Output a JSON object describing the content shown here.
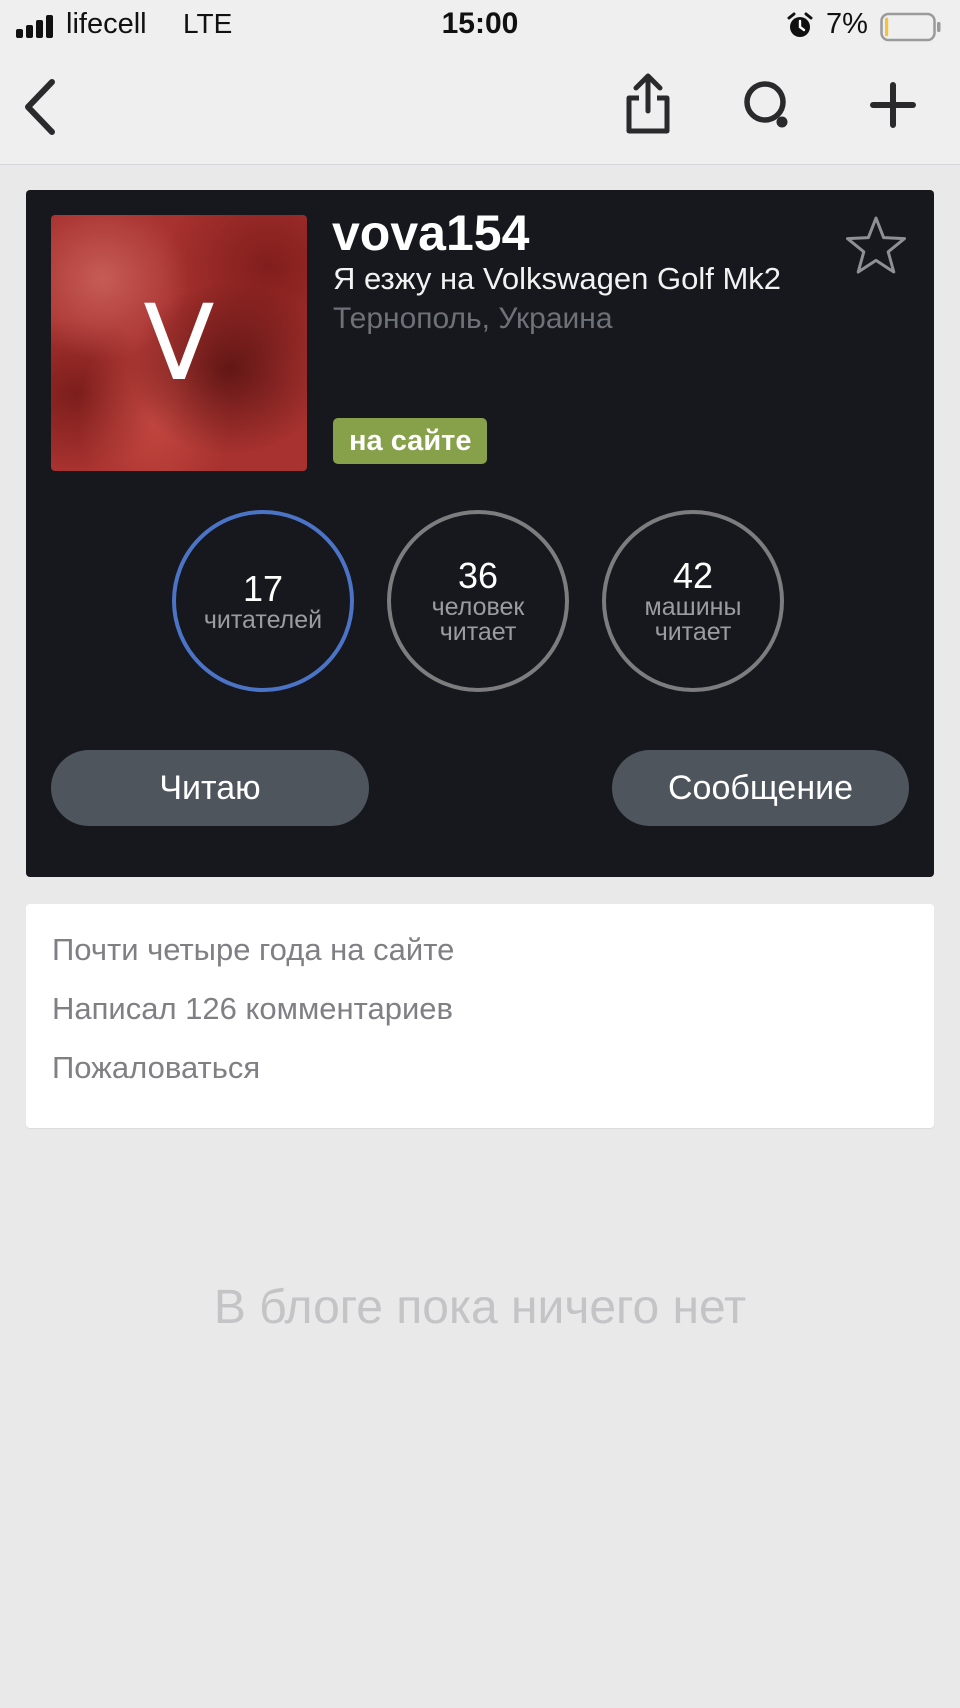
{
  "status_bar": {
    "carrier": "lifecell",
    "network": "LTE",
    "time": "15:00",
    "battery_percent": "7%",
    "battery_level": 0.07,
    "icons": [
      "signal-icon",
      "alarm-icon",
      "battery-icon"
    ]
  },
  "nav": {
    "icons": [
      "back-icon",
      "share-icon",
      "search-icon",
      "plus-icon"
    ]
  },
  "profile": {
    "avatar_letter": "V",
    "username": "vova154",
    "car": "Я езжу на Volkswagen Golf Mk2",
    "location": "Тернополь, Украина",
    "online_status": "на сайте",
    "favorite_icon": "star-outline-icon"
  },
  "stats": [
    {
      "value": "17",
      "label": "читателей",
      "label2": ""
    },
    {
      "value": "36",
      "label": "человек",
      "label2": "читает"
    },
    {
      "value": "42",
      "label": "машины",
      "label2": "читает"
    }
  ],
  "actions": {
    "follow_label": "Читаю",
    "message_label": "Сообщение"
  },
  "info": {
    "years": "Почти четыре года на сайте",
    "comments": "Написал 126 комментариев",
    "report": "Пожаловаться"
  },
  "blog": {
    "empty_message": "В блоге пока ничего нет"
  },
  "colors": {
    "card_bg": "#16181d",
    "online_badge": "#87a14a",
    "followers_ring": "#4b74c7",
    "stat_ring": "#7d7d7f",
    "button_bg": "#4e555d",
    "page_bg": "#e9e9ea"
  }
}
